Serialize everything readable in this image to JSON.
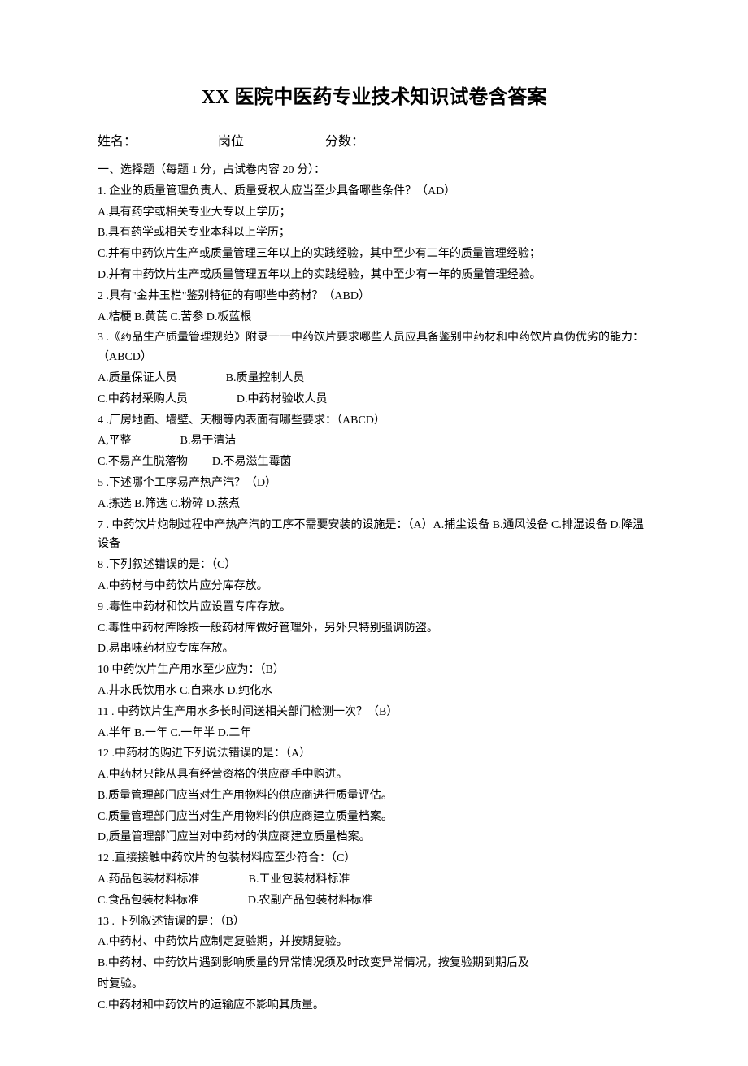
{
  "title": "XX 医院中医药专业技术知识试卷含答案",
  "header": {
    "name_label": "姓名：",
    "position_label": "岗位",
    "score_label": "分数："
  },
  "section1_header": "一、选择题（每题 1 分，占试卷内容 20 分）：",
  "q1": {
    "stem": "1. 企业的质量管理负责人、质量受权人应当至少具备哪些条件？（AD）",
    "a": "A.具有药学或相关专业大专以上学历；",
    "b": "B.具有药学或相关专业本科以上学历；",
    "c": "C.并有中药饮片生产或质量管理三年以上的实践经验，其中至少有二年的质量管理经验；",
    "d": "D.并有中药饮片生产或质量管理五年以上的实践经验，其中至少有一年的质量管理经验。"
  },
  "q2": {
    "stem": "2  .具有\"金井玉栏\"鉴别特征的有哪些中药材？（ABD）",
    "opts": "A.桔梗 B.黄芪 C.苦参 D.板蓝根"
  },
  "q3": {
    "stem": "3  .《药品生产质量管理规范》附录一一中药饮片要求哪些人员应具备鉴别中药材和中药饮片真伪优劣的能力：（ABCD）",
    "a": "A.质量保证人员",
    "b": "B.质量控制人员",
    "c": "C.中药材采购人员",
    "d": "D.中药材验收人员"
  },
  "q4": {
    "stem": "4  .厂房地面、墙壁、天棚等内表面有哪些要求：（ABCD）",
    "a": "A,平整",
    "b": "B.易于清洁",
    "c": "C.不易产生脱落物",
    "d": "D.不易滋生霉菌"
  },
  "q5": {
    "stem": "5  .下述哪个工序易产热产汽？（D）",
    "opts": "A.拣选 B.筛选 C.粉碎 D.蒸煮"
  },
  "q7": {
    "stem": "7  . 中药饮片炮制过程中产热产汽的工序不需要安装的设施是：（A）A.捕尘设备 B.通风设备 C.排湿设备 D.降温设备"
  },
  "q8": {
    "stem": "8  .下列叙述错误的是：（C）",
    "a": "A.中药材与中药饮片应分库存放。",
    "b": "9  .毒性中药材和饮片应设置专库存放。",
    "c": "C.毒性中药材库除按一般药材库做好管理外，另外只特别强调防盗。",
    "d": "D.易串味药材应专库存放。"
  },
  "q10": {
    "stem": "10  中药饮片生产用水至少应为：（B）",
    "opts": "A.井水氏饮用水 C.自来水 D.纯化水"
  },
  "q11": {
    "stem": "11  . 中药饮片生产用水多长时间送相关部门检测一次？（B）",
    "opts": "A.半年 B.一年 C.一年半 D.二年"
  },
  "q12a": {
    "stem": "12  .中药材的购进下列说法错误的是：（A）",
    "a": "A.中药材只能从具有经营资格的供应商手中购进。",
    "b": "B.质量管理部门应当对生产用物料的供应商进行质量评估。",
    "c": "C.质量管理部门应当对生产用物料的供应商建立质量档案。",
    "d": "D,质量管理部门应当对中药材的供应商建立质量档案。"
  },
  "q12b": {
    "stem": "12  .直接接触中药饮片的包装材料应至少符合：（C）",
    "a": "A.药品包装材料标准",
    "b": "B.工业包装材料标准",
    "c": "C.食品包装材料标准",
    "d": "D.农副产品包装材料标准"
  },
  "q13": {
    "stem": "13  . 下列叙述错误的是：（B）",
    "a": "A.中药材、中药饮片应制定复验期，并按期复验。",
    "b": "B.中药材、中药饮片遇到影响质量的异常情况须及时改变异常情况，按复验期到期后及",
    "b2": "时复验。",
    "c": "C.中药材和中药饮片的运输应不影响其质量。"
  }
}
